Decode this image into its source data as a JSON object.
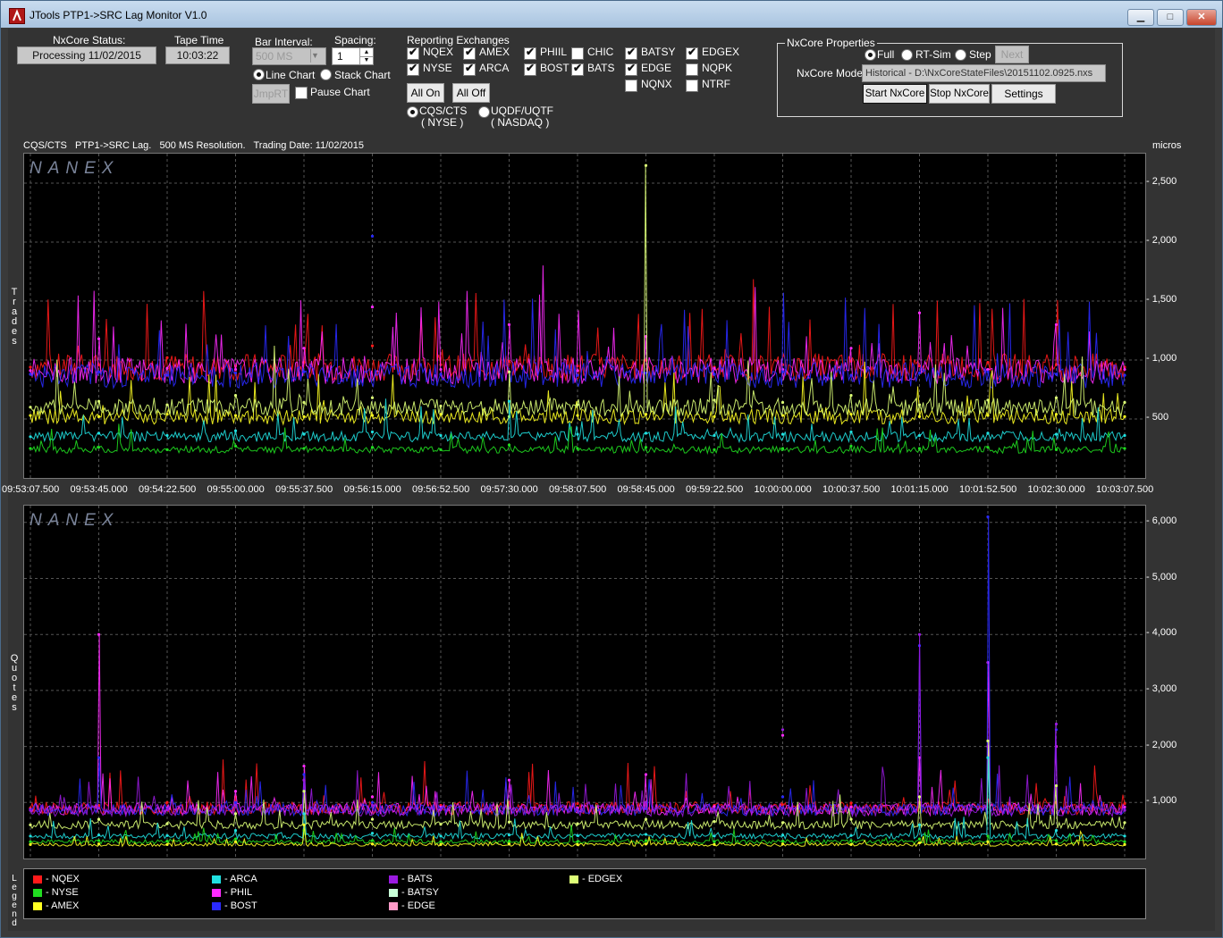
{
  "window": {
    "title": "JTools PTP1->SRC Lag Monitor V1.0"
  },
  "status": {
    "nxcore_status_label": "NxCore Status:",
    "nxcore_status_value": "Processing 11/02/2015",
    "tape_time_label": "Tape Time",
    "tape_time_value": "10:03:22"
  },
  "bar": {
    "interval_label": "Bar Interval:",
    "interval_value": "500 MS",
    "spacing_label": "Spacing:",
    "spacing_value": "1",
    "line_chart": "Line Chart",
    "stack_chart": "Stack Chart",
    "jmprt": "JmpRT",
    "pause_chart": "Pause Chart"
  },
  "exchanges": {
    "title": "Reporting Exchanges",
    "items": [
      {
        "label": "NQEX",
        "checked": true
      },
      {
        "label": "AMEX",
        "checked": true
      },
      {
        "label": "PHIIL",
        "checked": true
      },
      {
        "label": "CHIC",
        "checked": false
      },
      {
        "label": "BATSY",
        "checked": true
      },
      {
        "label": "EDGEX",
        "checked": true
      },
      {
        "label": "NYSE",
        "checked": true
      },
      {
        "label": "ARCA",
        "checked": true
      },
      {
        "label": "BOST",
        "checked": true
      },
      {
        "label": "BATS",
        "checked": true
      },
      {
        "label": "EDGE",
        "checked": true
      },
      {
        "label": "NQPK",
        "checked": false
      },
      {
        "label": "NQNX",
        "checked": false
      },
      {
        "label": "NTRF",
        "checked": false
      }
    ],
    "all_on": "All On",
    "all_off": "All Off",
    "cqs_line1": "CQS/CTS",
    "cqs_line2": "( NYSE )",
    "uqdf_line1": "UQDF/UQTF",
    "uqdf_line2": "( NASDAQ )"
  },
  "nxprops": {
    "title": "NxCore Properties",
    "full": "Full",
    "rtsim": "RT-Sim",
    "step": "Step",
    "next": "Next",
    "mode_label": "NxCore Mode:",
    "mode_value": "Historical - D:\\NxCoreStateFiles\\20151102.0925.nxs",
    "start": "Start NxCore",
    "stop": "Stop NxCore",
    "settings": "Settings"
  },
  "chart_header": {
    "info": "CQS/CTS   PTP1->SRC Lag.   500 MS Resolution.   Trading Date: 11/02/2015",
    "units": "micros",
    "watermark": "NANEX"
  },
  "chart_data": [
    {
      "type": "line",
      "panel": "Trades",
      "ylabel": "micros",
      "yticks": [
        "2,500",
        "2,000",
        "1,500",
        "1,000",
        "500"
      ],
      "x": [
        "09:53:07.500",
        "09:53:45.000",
        "09:54:22.500",
        "09:55:00.000",
        "09:55:37.500",
        "09:56:15.000",
        "09:56:52.500",
        "09:57:30.000",
        "09:58:07.500",
        "09:58:45.000",
        "09:59:22.500",
        "10:00:00.000",
        "10:00:37.500",
        "10:01:15.000",
        "10:01:52.500",
        "10:02:30.000",
        "10:03:07.500"
      ],
      "ylim": [
        0,
        2750
      ],
      "series": [
        {
          "name": "NQEX",
          "color": "#ff1a1a",
          "values": [
            940,
            960,
            1020,
            950,
            980,
            1120,
            960,
            990,
            950,
            1000,
            940,
            960,
            990,
            950,
            980,
            960,
            940
          ]
        },
        {
          "name": "PHIL",
          "color": "#ff2aff",
          "values": [
            910,
            1180,
            930,
            920,
            1100,
            1450,
            920,
            1300,
            910,
            1200,
            930,
            920,
            1100,
            1400,
            920,
            1300,
            920
          ]
        },
        {
          "name": "BOST",
          "color": "#2a2aff",
          "values": [
            880,
            900,
            870,
            890,
            900,
            2050,
            880,
            900,
            870,
            890,
            880,
            900,
            870,
            890,
            900,
            880,
            870
          ]
        },
        {
          "name": "AMEX",
          "color": "#ffff22",
          "values": [
            530,
            520,
            540,
            530,
            520,
            530,
            540,
            520,
            530,
            540,
            520,
            530,
            540,
            520,
            530,
            540,
            520
          ]
        },
        {
          "name": "EDGEX",
          "color": "#ddff77",
          "values": [
            600,
            650,
            620,
            700,
            640,
            680,
            610,
            900,
            620,
            2650,
            660,
            640,
            700,
            620,
            660,
            680,
            640
          ]
        },
        {
          "name": "ARCA",
          "color": "#20e0e0",
          "values": [
            350,
            380,
            360,
            400,
            370,
            390,
            360,
            650,
            370,
            380,
            360,
            370,
            390,
            360,
            380,
            370,
            360
          ]
        },
        {
          "name": "NYSE",
          "color": "#20dd20",
          "values": [
            250,
            260,
            240,
            270,
            250,
            260,
            240,
            280,
            250,
            260,
            240,
            250,
            270,
            250,
            260,
            240,
            250
          ]
        }
      ]
    },
    {
      "type": "line",
      "panel": "Quotes",
      "ylabel": "micros",
      "yticks": [
        "6,000",
        "5,000",
        "4,000",
        "3,000",
        "2,000",
        "1,000"
      ],
      "ylim": [
        0,
        6300
      ],
      "series": [
        {
          "name": "NQEX",
          "color": "#ff1a1a",
          "values": [
            900,
            950,
            1000,
            1100,
            1400,
            1100,
            950,
            1000,
            980,
            1000,
            950,
            960,
            990,
            1000,
            1050,
            1000,
            980
          ]
        },
        {
          "name": "PHIL",
          "color": "#ff2aff",
          "values": [
            880,
            4000,
            900,
            1200,
            1650,
            1100,
            920,
            1400,
            900,
            1500,
            930,
            2200,
            920,
            1800,
            3500,
            2000,
            920
          ]
        },
        {
          "name": "BOST",
          "color": "#2a2aff",
          "values": [
            870,
            1800,
            880,
            1000,
            1500,
            1000,
            880,
            900,
            870,
            890,
            880,
            1100,
            870,
            3800,
            6100,
            2300,
            870
          ]
        },
        {
          "name": "BATS",
          "color": "#9a1ae0",
          "values": [
            860,
            900,
            870,
            950,
            1400,
            950,
            870,
            900,
            860,
            1000,
            870,
            2300,
            860,
            4000,
            2000,
            2400,
            860
          ]
        },
        {
          "name": "EDGEX",
          "color": "#ddff77",
          "values": [
            600,
            700,
            620,
            800,
            1200,
            700,
            610,
            650,
            620,
            700,
            660,
            640,
            700,
            1100,
            2100,
            1300,
            640
          ]
        },
        {
          "name": "ARCA",
          "color": "#20e0e0",
          "values": [
            400,
            420,
            410,
            500,
            800,
            450,
            400,
            420,
            410,
            430,
            400,
            420,
            410,
            600,
            1800,
            500,
            400
          ]
        },
        {
          "name": "NYSE",
          "color": "#20dd20",
          "values": [
            300,
            320,
            310,
            350,
            500,
            320,
            300,
            310,
            300,
            320,
            300,
            310,
            320,
            350,
            400,
            320,
            300
          ]
        },
        {
          "name": "AMEX",
          "color": "#ffff22",
          "values": [
            250,
            260,
            250,
            300,
            600,
            260,
            250,
            260,
            250,
            260,
            250,
            260,
            250,
            280,
            300,
            260,
            250
          ]
        }
      ]
    }
  ],
  "panel_labels": {
    "trades": "Trades",
    "quotes": "Quotes",
    "legend": "Legend"
  },
  "legend": [
    {
      "name": "NQEX",
      "color": "#ff1a1a"
    },
    {
      "name": "NYSE",
      "color": "#20dd20"
    },
    {
      "name": "AMEX",
      "color": "#ffff22"
    },
    {
      "name": "ARCA",
      "color": "#20e0e0"
    },
    {
      "name": "PHIL",
      "color": "#ff2aff"
    },
    {
      "name": "BOST",
      "color": "#2a2aff"
    },
    {
      "name": "BATS",
      "color": "#9a1ae0"
    },
    {
      "name": "BATSY",
      "color": "#c8ffd8"
    },
    {
      "name": "EDGE",
      "color": "#ff9ac8"
    },
    {
      "name": "EDGEX",
      "color": "#ddff77"
    }
  ]
}
